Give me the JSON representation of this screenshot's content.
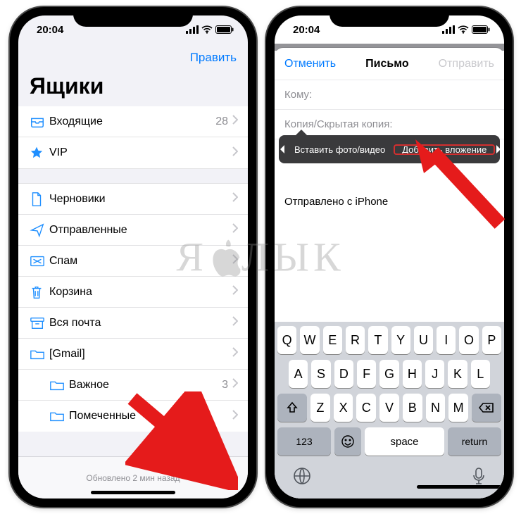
{
  "status": {
    "time": "20:04"
  },
  "left": {
    "edit": "Править",
    "title": "Ящики",
    "rows": {
      "inbox": {
        "label": "Входящие",
        "count": "28"
      },
      "vip": {
        "label": "VIP"
      },
      "drafts": {
        "label": "Черновики"
      },
      "sent": {
        "label": "Отправленные"
      },
      "spam": {
        "label": "Спам"
      },
      "trash": {
        "label": "Корзина"
      },
      "allmail": {
        "label": "Вся почта"
      },
      "gmail": {
        "label": "[Gmail]"
      },
      "important": {
        "label": "Важное",
        "count": "3"
      },
      "starred": {
        "label": "Помеченные"
      }
    },
    "updated": "Обновлено 2 мин назад"
  },
  "right": {
    "cancel": "Отменить",
    "title": "Письмо",
    "send": "Отправить",
    "to_label": "Кому:",
    "cc_label": "Копия/Скрытая копия:",
    "callout": {
      "insert_media": "Вставить фото/видео",
      "add_attachment": "Добавить вложение"
    },
    "signature": "Отправлено с iPhone",
    "keys_row1": [
      "Q",
      "W",
      "E",
      "R",
      "T",
      "Y",
      "U",
      "I",
      "O",
      "P"
    ],
    "keys_row2": [
      "A",
      "S",
      "D",
      "F",
      "G",
      "H",
      "J",
      "K",
      "L"
    ],
    "keys_row3": [
      "Z",
      "X",
      "C",
      "V",
      "B",
      "N",
      "M"
    ],
    "key_123": "123",
    "key_space": "space",
    "key_return": "return"
  },
  "watermark": {
    "left": "Я",
    "right": "ЛЫК"
  }
}
